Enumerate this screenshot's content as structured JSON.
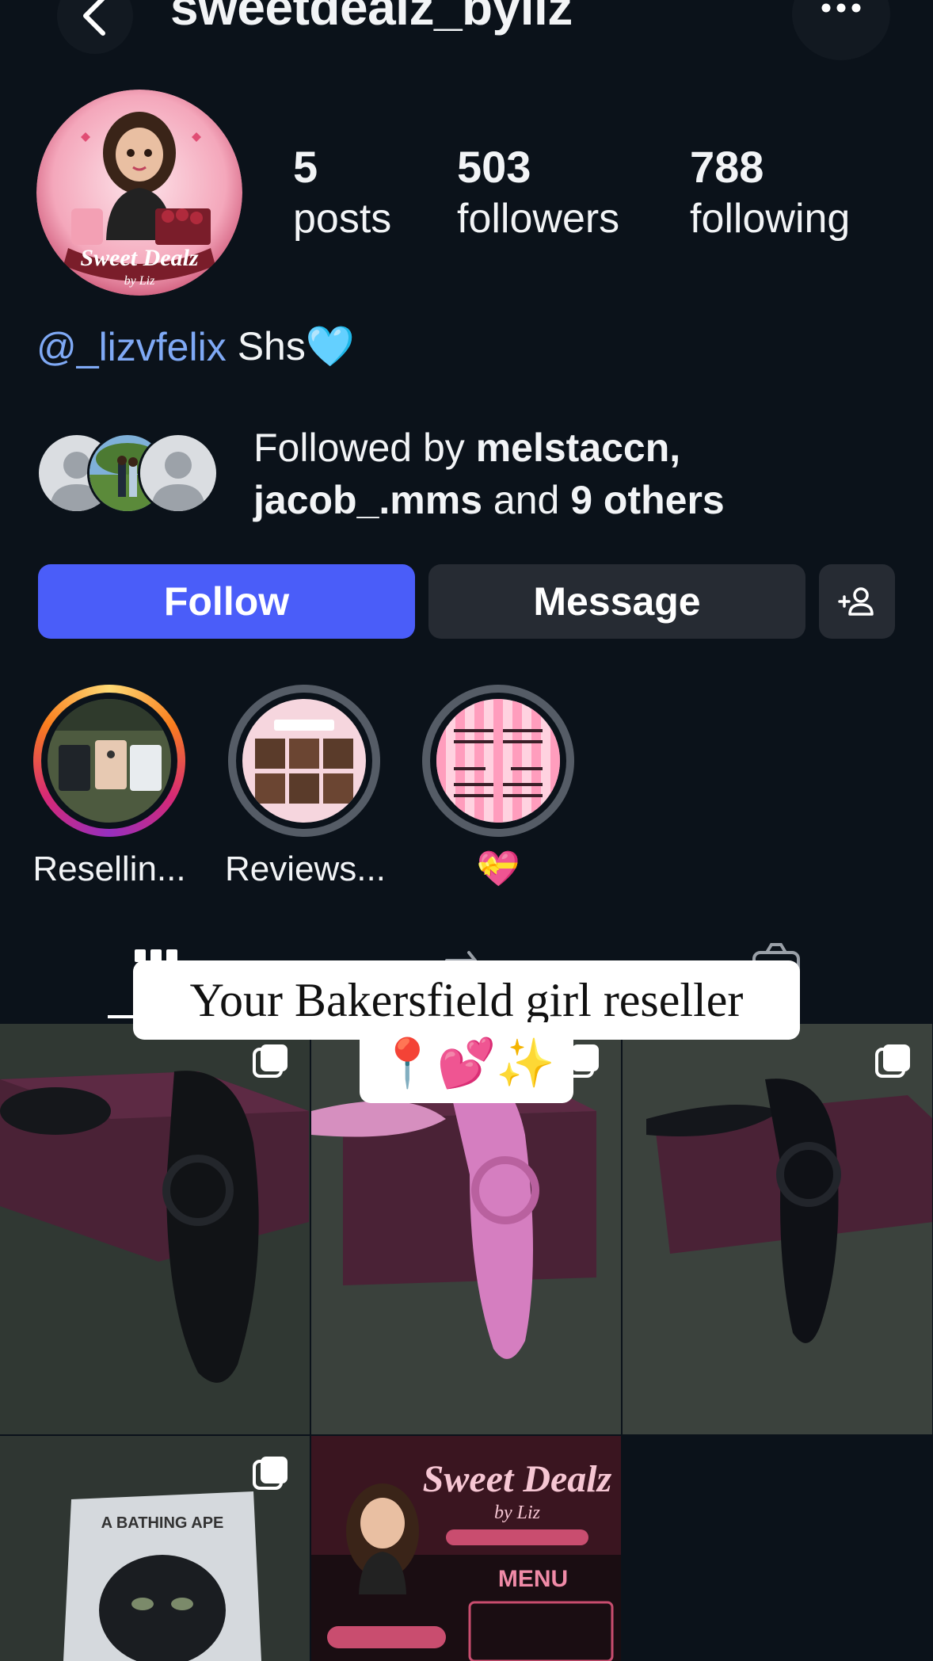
{
  "header": {
    "username": "sweetdealz_byliz",
    "back_icon": "chevron-left-icon",
    "more_icon": "more-horizontal-icon"
  },
  "profile": {
    "avatar_icon": "sweet-dealz-logo-avatar",
    "stats": [
      {
        "value": "5",
        "label": "posts"
      },
      {
        "value": "503",
        "label": "followers"
      },
      {
        "value": "788",
        "label": "following"
      }
    ],
    "bio": {
      "mention": "@_lizvfelix",
      "text": "Shs",
      "emoji": "🩵"
    },
    "followed_by": {
      "prefix": "Followed by ",
      "user1": "melstaccn",
      "sep": ",",
      "user2": "jacob_.mms",
      "middle": " and ",
      "others": "9 others"
    }
  },
  "actions": {
    "follow_label": "Follow",
    "message_label": "Message",
    "add_user_icon": "add-user-icon"
  },
  "highlights": [
    {
      "label": "Resellin..."
    },
    {
      "label": "Reviews..."
    },
    {
      "label": "💝"
    }
  ],
  "tabs": [
    "grid-icon",
    "reels-icon",
    "tagged-icon"
  ],
  "stickers": {
    "text": "Your Bakersfield girl reseller",
    "emojis": "📍💕✨"
  },
  "colors": {
    "background": "#0b121a",
    "follow_button": "#4a5df9",
    "secondary_button": "#262b33",
    "mention": "#7fa9f5"
  }
}
